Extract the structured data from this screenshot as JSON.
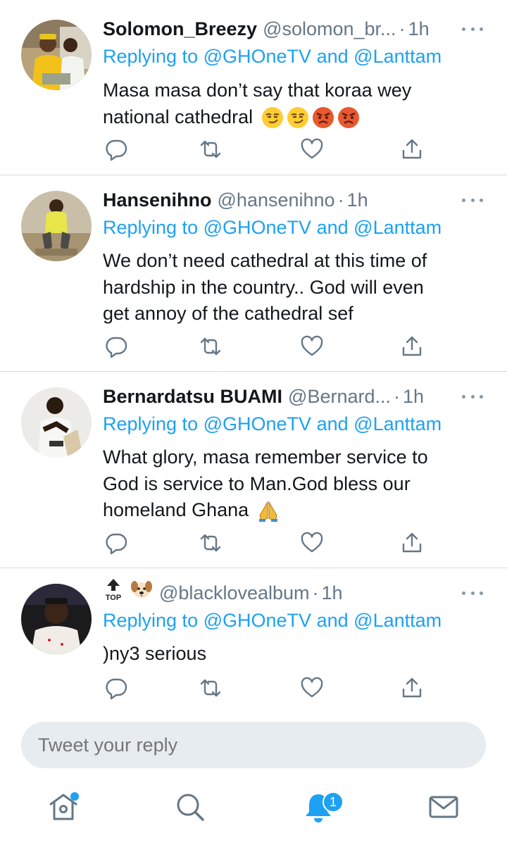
{
  "tweets": [
    {
      "name": "Solomon_Breezy",
      "handle": "@solomon_br...",
      "time": "1h",
      "reply_prefix": "Replying to",
      "reply_user1": "@GHOneTV",
      "reply_and": "and",
      "reply_user2": "@Lanttam",
      "lines": [
        "Masa masa don’t say that koraa wey",
        "national cathedral"
      ],
      "emojis": [
        "smirk-emoji",
        "smirk-emoji",
        "angry-emoji",
        "angry-emoji"
      ]
    },
    {
      "name": "Hansenihno",
      "handle": "@hansenihno",
      "time": "1h",
      "reply_prefix": "Replying to",
      "reply_user1": "@GHOneTV",
      "reply_and": "and",
      "reply_user2": "@Lanttam",
      "lines": [
        "We don’t need cathedral at this time of",
        "hardship in the country.. God will even",
        "get annoy of the cathedral sef"
      ]
    },
    {
      "name": "Bernardatsu BUAMI",
      "handle": "@Bernard...",
      "time": "1h",
      "reply_prefix": "Replying to",
      "reply_user1": "@GHOneTV",
      "reply_and": "and",
      "reply_user2": "@Lanttam",
      "lines": [
        "What glory, masa remember service to",
        "God is service to Man.God bless our",
        "homeland Ghana"
      ],
      "emojis": [
        "folded-hands-emoji"
      ]
    },
    {
      "name": "",
      "name_icons": [
        "top-arrow-emoji",
        "dog-face-emoji"
      ],
      "top_label": "TOP",
      "handle": "@blackl‍ovealbum",
      "time": "1h",
      "reply_prefix": "Replying to",
      "reply_user1": "@GHOneTV",
      "reply_and": "and",
      "reply_user2": "@Lanttam",
      "lines": [
        ")ny3 serious"
      ]
    }
  ],
  "composer": {
    "placeholder": "Tweet your reply"
  },
  "tabbar": {
    "items": [
      "home-icon",
      "search-icon",
      "notifications-icon",
      "messages-icon"
    ],
    "notifications_count": "1"
  },
  "colors": {
    "accent": "#1da1f2",
    "secondary_text": "#657786",
    "divider": "#d6dbe0"
  }
}
